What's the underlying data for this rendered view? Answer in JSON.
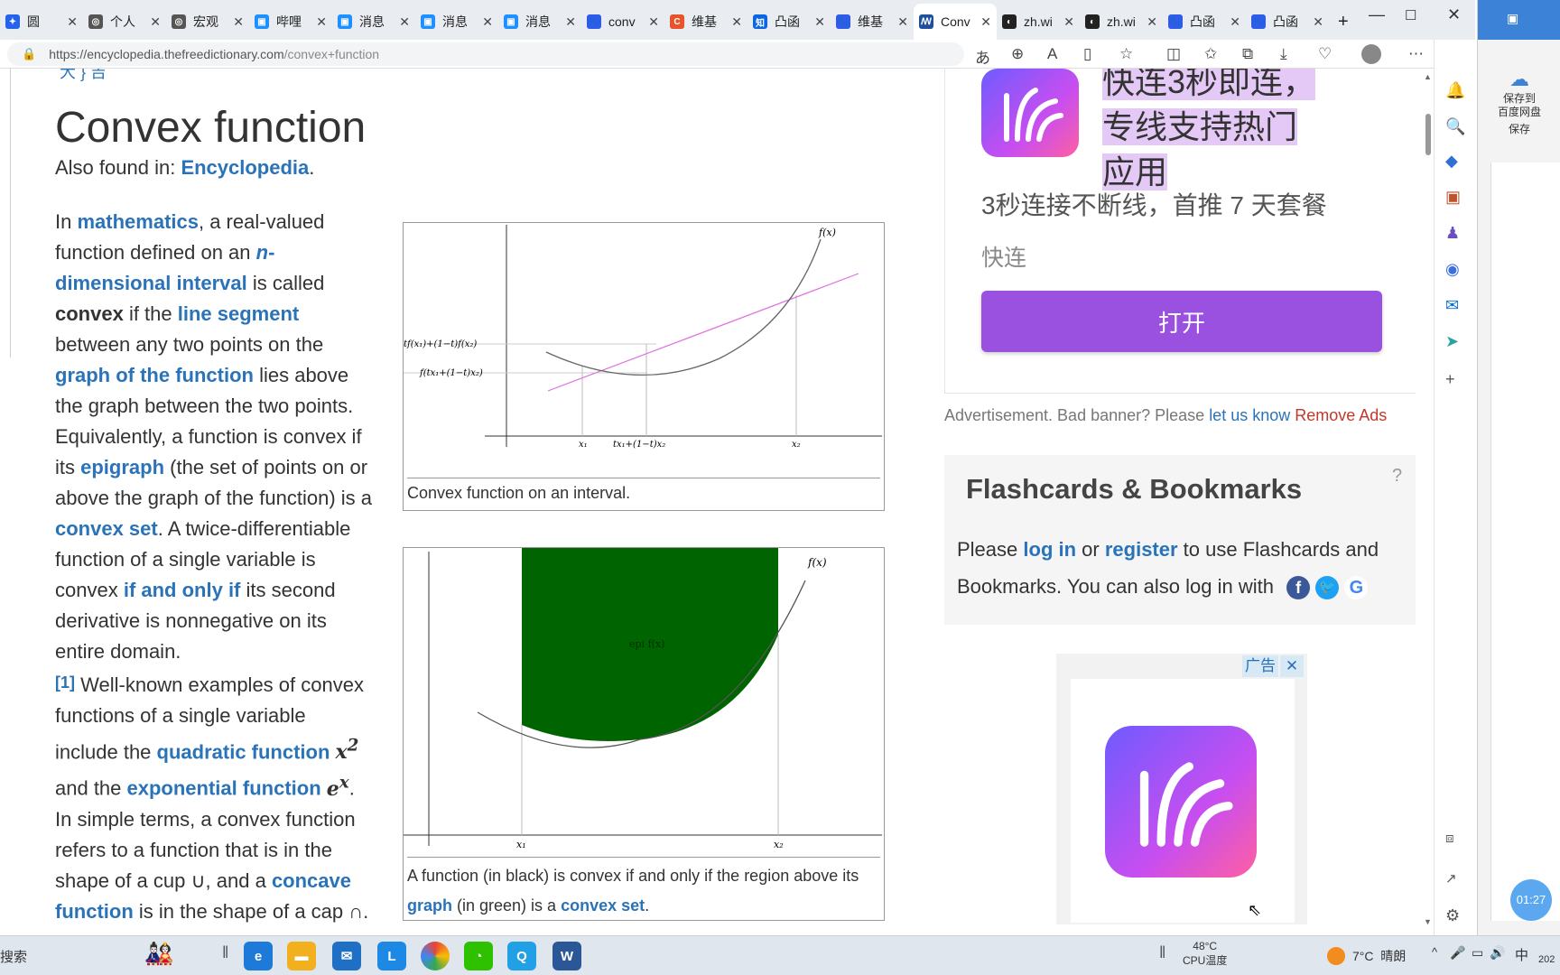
{
  "browser": {
    "tabs": [
      {
        "label": "圆",
        "color": "#2563eb",
        "glyph": "✦"
      },
      {
        "label": "个人",
        "color": "#555",
        "glyph": "◎"
      },
      {
        "label": "宏观",
        "color": "#555",
        "glyph": "◎"
      },
      {
        "label": "哔哩",
        "color": "#1e90ff",
        "glyph": "▣"
      },
      {
        "label": "消息",
        "color": "#1e90ff",
        "glyph": "▣"
      },
      {
        "label": "消息",
        "color": "#1e90ff",
        "glyph": "▣"
      },
      {
        "label": "消息",
        "color": "#1e90ff",
        "glyph": "▣"
      },
      {
        "label": "conv",
        "color": "#2f5bea",
        "glyph": "🐾"
      },
      {
        "label": "维基",
        "color": "#e8532b",
        "glyph": "C"
      },
      {
        "label": "凸函",
        "color": "#0a66e4",
        "glyph": "知"
      },
      {
        "label": "维基",
        "color": "#2f5bea",
        "glyph": "🐾"
      },
      {
        "label": "Conv",
        "color": "#1e4f9a",
        "glyph": "ꟿ"
      },
      {
        "label": "zh.wi",
        "color": "#222",
        "glyph": "◐"
      },
      {
        "label": "zh.wi",
        "color": "#222",
        "glyph": "◐"
      },
      {
        "label": "凸函",
        "color": "#2f5bea",
        "glyph": "🐾"
      },
      {
        "label": "凸函",
        "color": "#2f5bea",
        "glyph": "🐾"
      }
    ],
    "url_host": "https://encyclopedia.thefreedictionary.com",
    "url_path": "/convex+function"
  },
  "article": {
    "top_cut": "大 } 吉",
    "title": "Convex function",
    "also_found_prefix": "Also found in: ",
    "also_found_link": "Encyclopedia",
    "also_found_suffix": ".",
    "p_in": "In ",
    "l_mathematics": "mathematics",
    "t1": ", a real-valued function defined on an ",
    "l_n": "n",
    "l_dim": "-dimensional interval",
    "t2": " is called ",
    "b_convex": "convex",
    "t3": " if the ",
    "l_line": "line segment",
    "t4": " between any two points on the ",
    "l_graph": "graph of the function",
    "t5": " lies above the graph between the two points. Equivalently, a function is convex if its ",
    "l_epigraph": "epigraph",
    "t6": " (the set of points on or above the graph of the function) is a ",
    "l_convexset": "convex set",
    "t7": ". A twice-differentiable function of a single variable is convex ",
    "l_iff": "if and only if",
    "t8": " its second derivative is nonnegative on its entire domain.",
    "ref1": "[1]",
    "t9": " Well-known examples of convex functions of a single variable include the ",
    "l_quadratic": "quadratic function",
    "m_x2": "x",
    "m_x2_sup": "2",
    "t10": " and the ",
    "l_exponential": "exponential function",
    "m_ex": "e",
    "m_ex_sup": "x",
    "t11": ". In simple terms, a convex function refers to a function that is in the shape of a cup ∪, and a ",
    "l_concave": "concave function",
    "t12": " is in the shape of a cap ∩."
  },
  "figure1": {
    "caption": "Convex function on an interval.",
    "label_fx": "f(x)",
    "label_chord": "tf(x₁)+(1−t)f(x₂)",
    "label_fval": "f(tx₁+(1−t)x₂)",
    "tick_x1": "x₁",
    "tick_mid": "tx₁+(1−t)x₂",
    "tick_x2": "x₂"
  },
  "figure2": {
    "caption_pre": "A function (in black) is convex if and only if the region above its ",
    "caption_link1": "graph",
    "caption_mid": " (in green) is a ",
    "caption_link2": "convex set",
    "caption_end": ".",
    "label_fx": "f(x)",
    "label_epi": "epi f(x)",
    "tick_x1": "x₁",
    "tick_x2": "x₂"
  },
  "ad_top": {
    "headline_l1": "快连3秒即连，",
    "headline_l2": "专线支持热门",
    "headline_l3": "应用",
    "subline": "3秒连接不断线，首推 7 天套餐",
    "brand": "快连",
    "open_button": "打开"
  },
  "ad_notice": {
    "text": "Advertisement. Bad banner? Please ",
    "link": "let us know",
    "remove": "Remove Ads"
  },
  "flashcards": {
    "title": "Flashcards & Bookmarks",
    "help": "?",
    "p1": "Please ",
    "login": "log in",
    "p2": " or ",
    "register": "register",
    "p3": " to use Flashcards and Bookmarks. You can also log in with"
  },
  "ad_bottom": {
    "badge": "广告",
    "close": "✕"
  },
  "sidebar_right": {
    "save_l1": "保存到",
    "save_l2": "百度网盘",
    "save_l3": "保存"
  },
  "taskbar": {
    "search": "搜索",
    "temp": "48°C",
    "temp_label": "CPU温度",
    "weather": "7°C  晴朗",
    "ime": "中",
    "year": "202",
    "clock": "01:27"
  },
  "colors": {
    "link": "#2a73b8",
    "ad_purple": "#9b51e0",
    "epigraph_green": "#006400",
    "remove_ads": "#c0392b"
  }
}
